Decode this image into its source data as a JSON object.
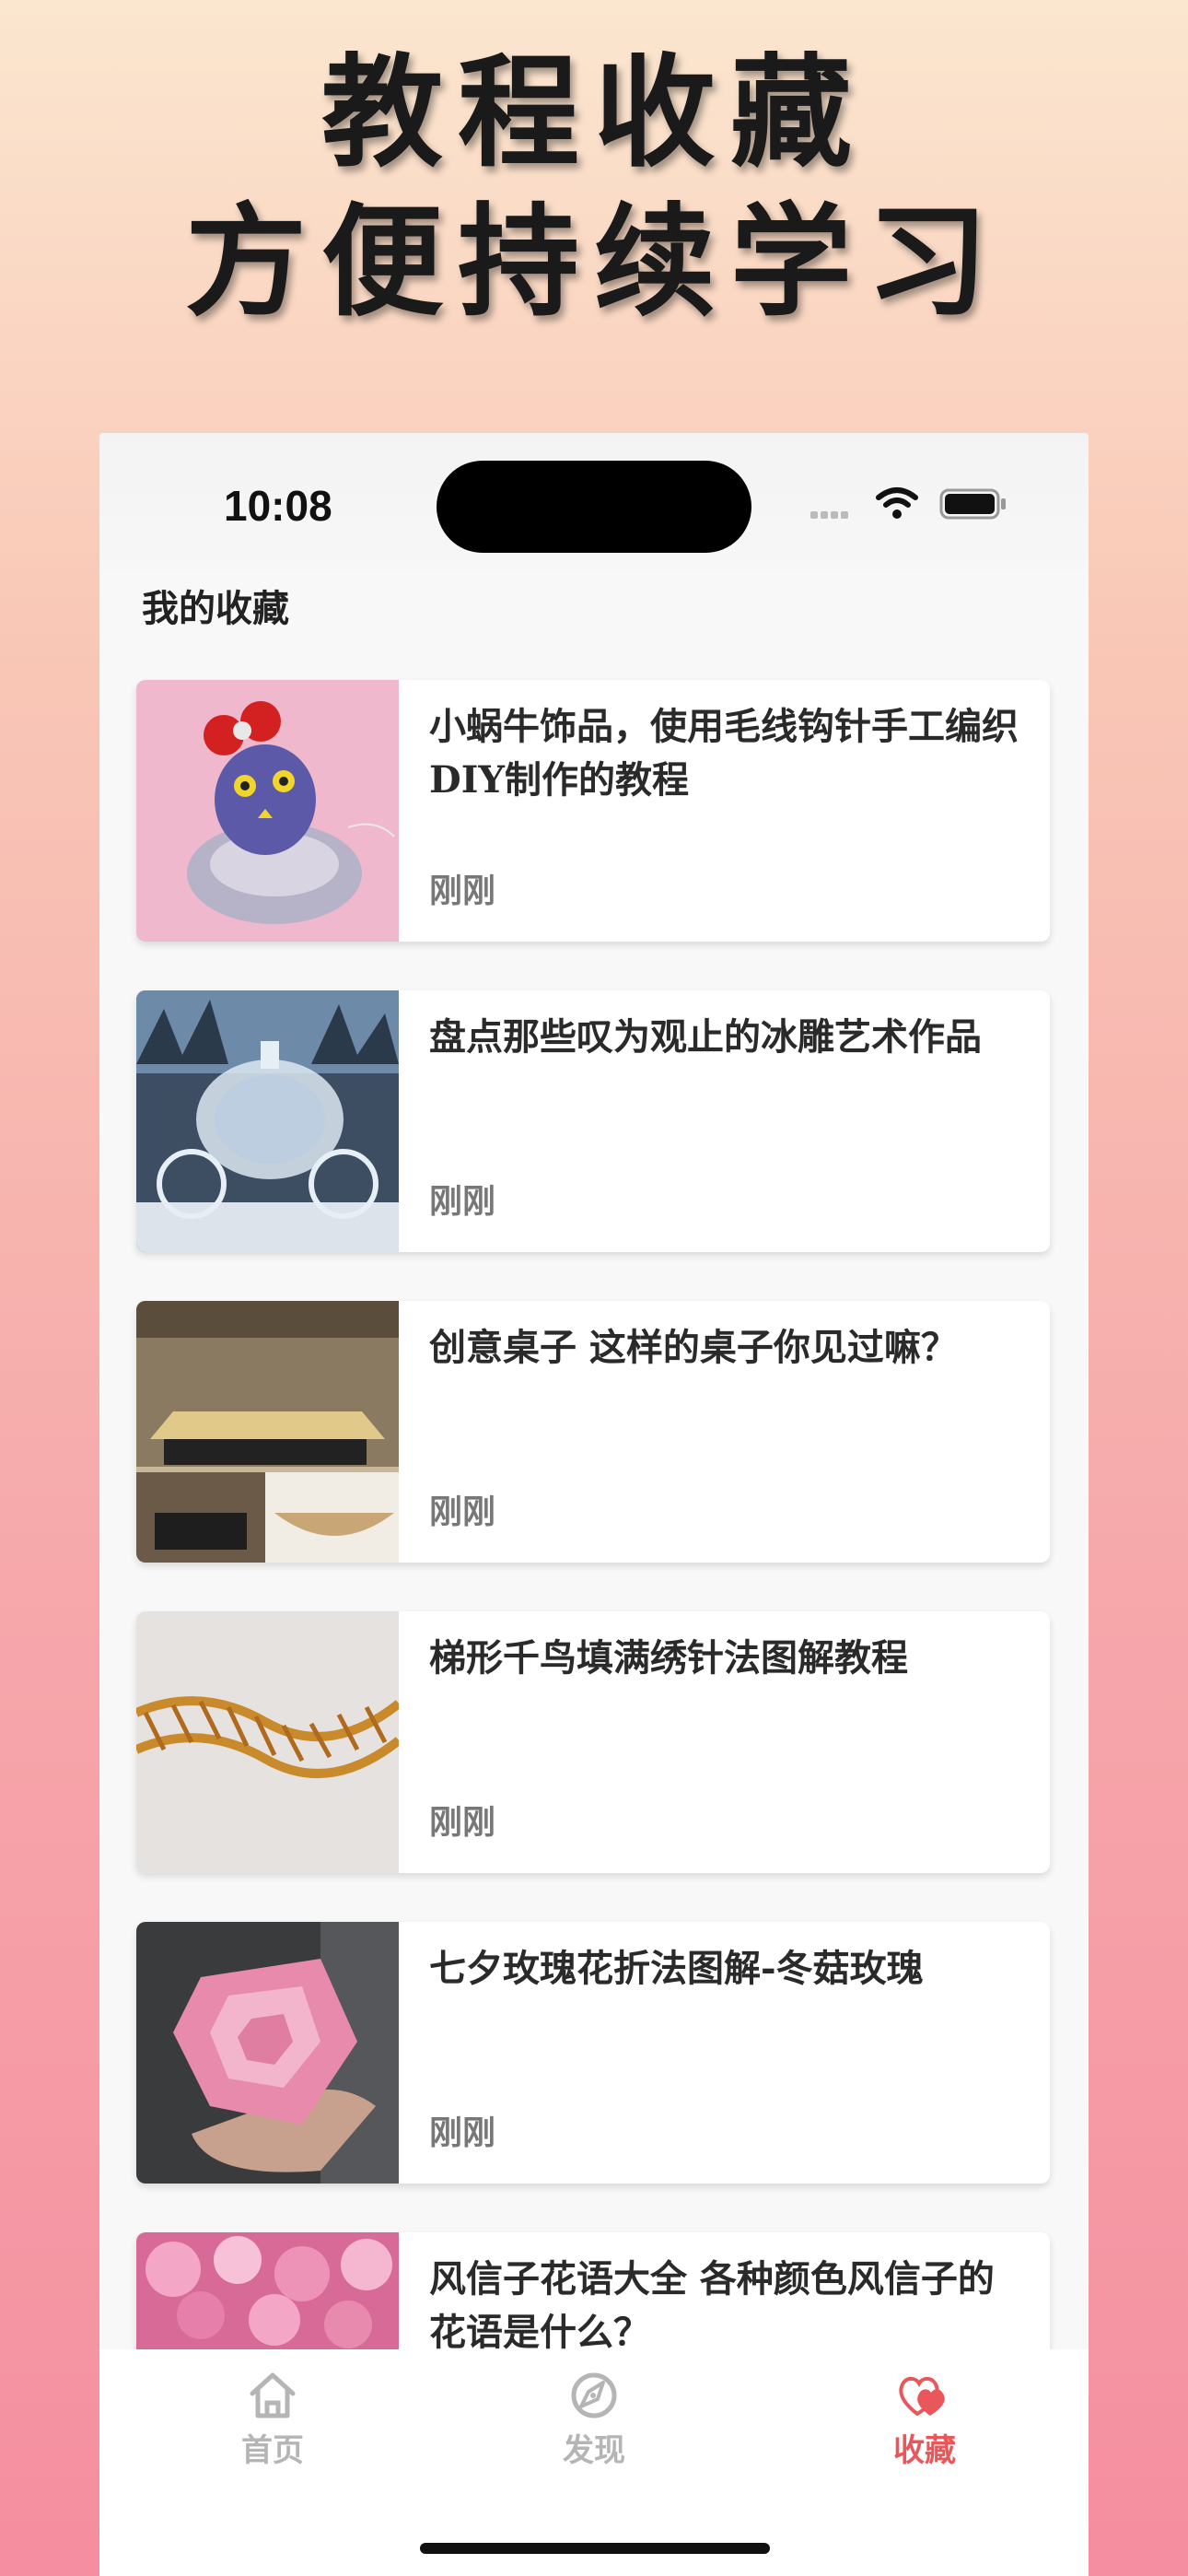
{
  "promo": {
    "line1": "教程收藏",
    "line2": "方便持续学习"
  },
  "status_bar": {
    "time": "10:08"
  },
  "page": {
    "title": "我的收藏"
  },
  "favorites": [
    {
      "title": "小蜗牛饰品，使用毛线钩针手工编织DIY制作的教程",
      "time": "刚刚"
    },
    {
      "title": "盘点那些叹为观止的冰雕艺术作品",
      "time": "刚刚"
    },
    {
      "title": "创意桌子 这样的桌子你见过嘛？",
      "time": "刚刚"
    },
    {
      "title": "梯形千鸟填满绣针法图解教程",
      "time": "刚刚"
    },
    {
      "title": "七夕玫瑰花折法图解-冬菇玫瑰",
      "time": "刚刚"
    },
    {
      "title": "风信子花语大全 各种颜色风信子的花语是什么？",
      "time": ""
    }
  ],
  "tabbar": {
    "home": "首页",
    "discover": "发现",
    "favorites": "收藏",
    "active_color": "#e8575a",
    "inactive_color": "#b5b5b5"
  }
}
